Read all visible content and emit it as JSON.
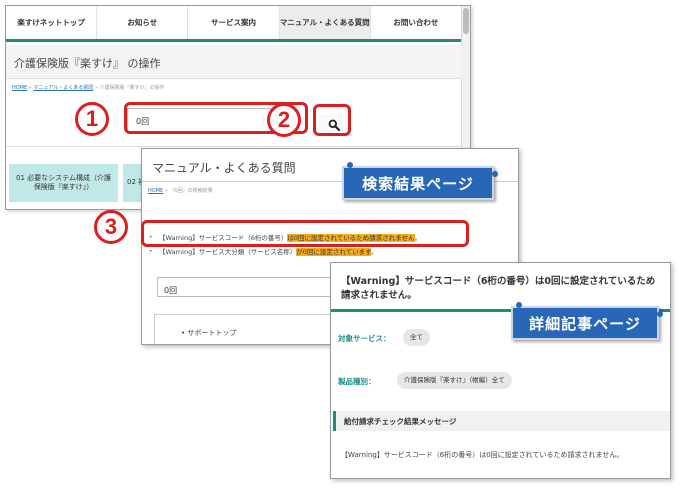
{
  "top_page": {
    "nav": [
      "楽すけネットトップ",
      "お知らせ",
      "サービス案内",
      "マニュアル・よくある質問",
      "お問い合わせ"
    ],
    "active_nav": "マニュアル・よくある質問",
    "page_title": "介護保険版『楽すけ』 の操作",
    "breadcrumb": {
      "home": "HOME",
      "sep1": "»",
      "manual": "マニュアル・よくある質問",
      "sep2": "»",
      "current": "介護保険版『楽すけ』の操作"
    },
    "search_value": "0回",
    "categories": [
      "01 必要なシステム構成（介護保険版『楽すけ』）",
      "02 初"
    ]
  },
  "results_page": {
    "title": "マニュアル・よくある質問",
    "breadcrumb": {
      "home": "HOME",
      "sep": "»",
      "current": "『0回』の検索結果"
    },
    "results": [
      {
        "prefix": "【Warning】サービスコード（6桁の番号）",
        "highlight": "は0回に設定されているため請求されません",
        "suffix": "。"
      },
      {
        "prefix": "【Warning】サービス大分類（サービス名称）",
        "highlight": "が0回に設定されています",
        "suffix": "。"
      }
    ],
    "search_value": "0回",
    "sidebar_item": "サポートトップ"
  },
  "detail_page": {
    "title": "【Warning】サービスコード（6桁の番号）は0回に設定されているため請求されません。",
    "target_service_label": "対象サービス：",
    "target_service_value": "全て",
    "product_label": "製品種別：",
    "product_value": "介護保険版『楽すけ』（帳編）全て",
    "section_heading": "給付請求チェック結果メッセージ",
    "message": "【Warning】サービスコード（6桁の番号）は0回に設定されているため請求されません。"
  },
  "annotations": {
    "step1": "1",
    "step2": "2",
    "step3": "3",
    "callout_results": "検索結果ページ",
    "callout_detail": "詳細記事ページ"
  },
  "colors": {
    "accent_teal": "#1e8c78",
    "highlight_orange": "#f5ad1b",
    "annotation_red": "#d92020",
    "callout_blue": "#2866b7",
    "category_cyan": "#bfe8e7"
  }
}
